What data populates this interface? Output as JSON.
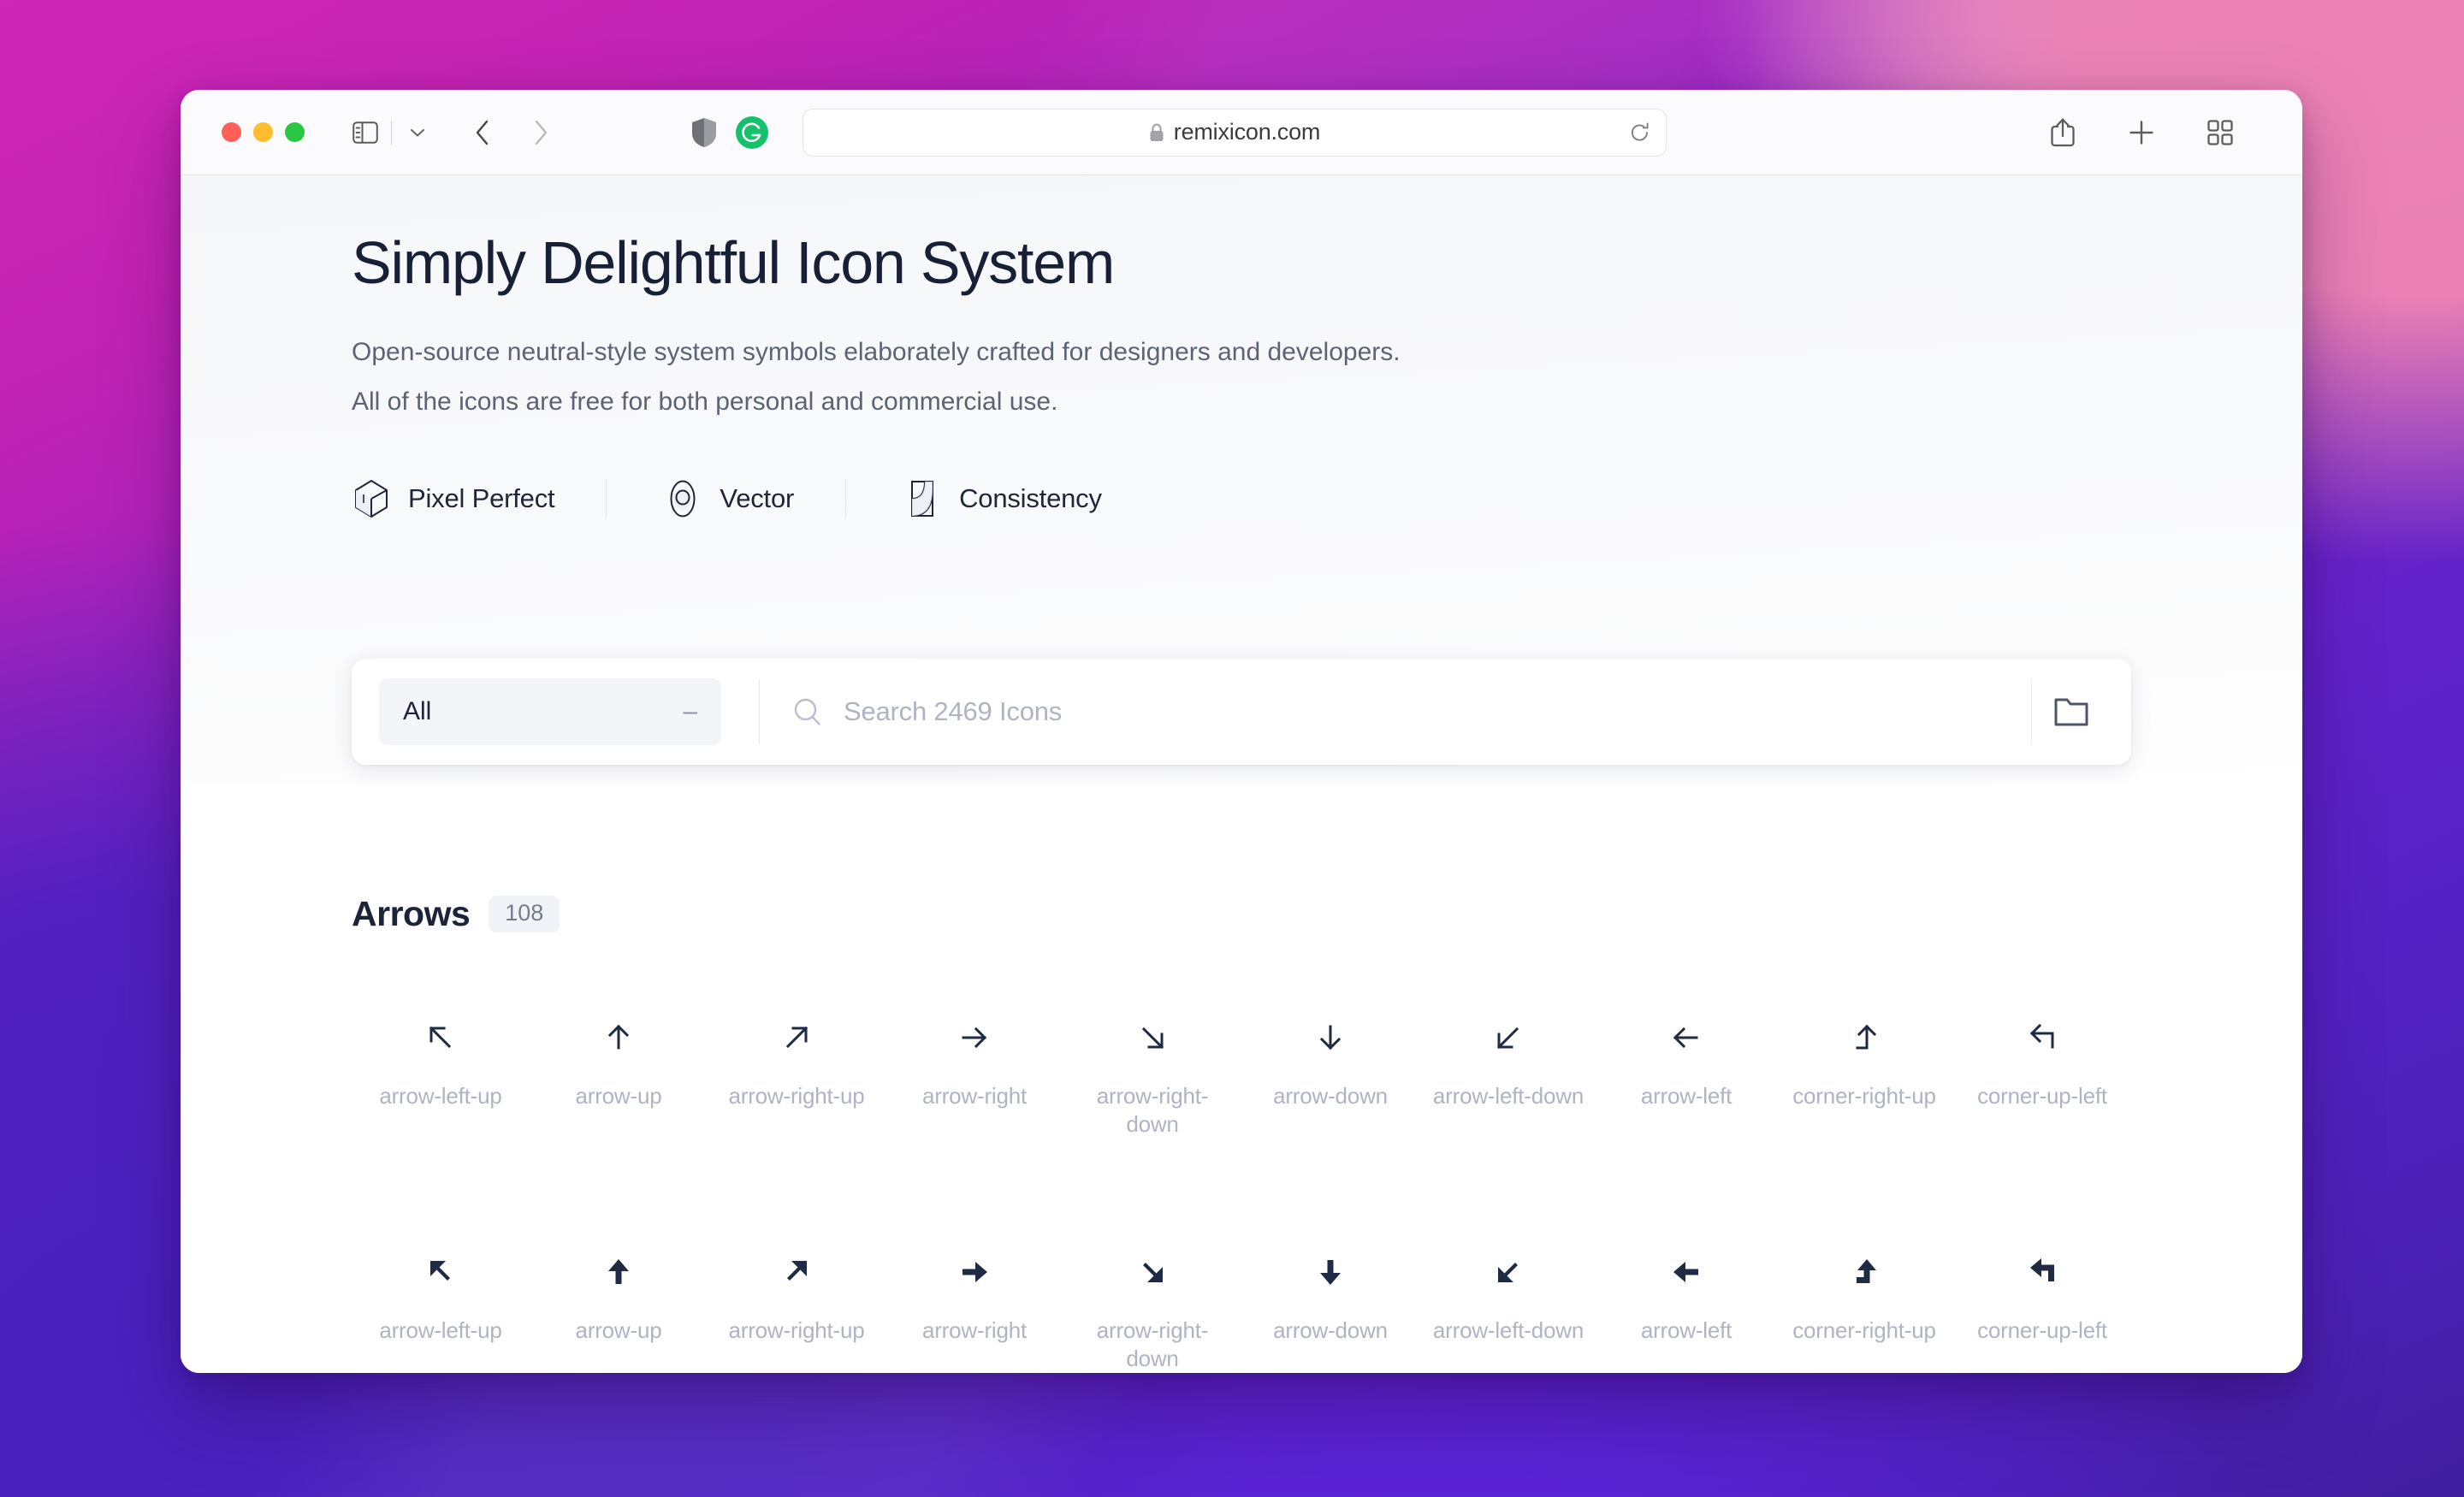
{
  "browser": {
    "url": "remixicon.com",
    "lock_icon": "lock-icon",
    "reload_icon": "reload-icon",
    "sidebar_icon": "sidebar-toggle-icon",
    "tab_overview_icon": "tab-overview-icon",
    "back_icon": "chevron-left-icon",
    "forward_icon": "chevron-right-icon",
    "share_icon": "share-icon",
    "new_tab_icon": "plus-icon",
    "extensions": [
      {
        "name": "shield-icon",
        "label": "Shield"
      },
      {
        "name": "grammarly-icon",
        "label": "G"
      }
    ]
  },
  "hero": {
    "title": "Simply Delightful Icon System",
    "subtitle_line1": "Open-source neutral-style system symbols elaborately crafted for designers and developers.",
    "subtitle_line2": "All of the icons are free for both personal and commercial use.",
    "features": [
      {
        "label": "Pixel Perfect",
        "icon": "cube-icon"
      },
      {
        "label": "Vector",
        "icon": "circle-vector-icon"
      },
      {
        "label": "Consistency",
        "icon": "square-curve-icon"
      }
    ]
  },
  "search": {
    "category_label": "All",
    "category_indicator": "–",
    "placeholder": "Search 2469 Icons",
    "search_icon": "search-icon",
    "folder_icon": "folder-icon"
  },
  "catalog": {
    "section_title": "Arrows",
    "section_count": "108",
    "rows": [
      {
        "style": "line",
        "icons": [
          {
            "name": "arrow-left-up",
            "glyph": "arrow-left-up-line-icon"
          },
          {
            "name": "arrow-up",
            "glyph": "arrow-up-line-icon"
          },
          {
            "name": "arrow-right-up",
            "glyph": "arrow-right-up-line-icon"
          },
          {
            "name": "arrow-right",
            "glyph": "arrow-right-line-icon"
          },
          {
            "name": "arrow-right-down",
            "glyph": "arrow-right-down-line-icon"
          },
          {
            "name": "arrow-down",
            "glyph": "arrow-down-line-icon"
          },
          {
            "name": "arrow-left-down",
            "glyph": "arrow-left-down-line-icon"
          },
          {
            "name": "arrow-left",
            "glyph": "arrow-left-line-icon"
          },
          {
            "name": "corner-right-up",
            "glyph": "corner-right-up-line-icon"
          },
          {
            "name": "corner-up-left",
            "glyph": "corner-up-left-line-icon"
          }
        ]
      },
      {
        "style": "fill",
        "icons": [
          {
            "name": "arrow-left-up",
            "glyph": "arrow-left-up-fill-icon"
          },
          {
            "name": "arrow-up",
            "glyph": "arrow-up-fill-icon"
          },
          {
            "name": "arrow-right-up",
            "glyph": "arrow-right-up-fill-icon"
          },
          {
            "name": "arrow-right",
            "glyph": "arrow-right-fill-icon"
          },
          {
            "name": "arrow-right-down",
            "glyph": "arrow-right-down-fill-icon"
          },
          {
            "name": "arrow-down",
            "glyph": "arrow-down-fill-icon"
          },
          {
            "name": "arrow-left-down",
            "glyph": "arrow-left-down-fill-icon"
          },
          {
            "name": "arrow-left",
            "glyph": "arrow-left-fill-icon"
          },
          {
            "name": "corner-right-up",
            "glyph": "corner-right-up-fill-icon"
          },
          {
            "name": "corner-up-left",
            "glyph": "corner-up-left-fill-icon"
          }
        ]
      }
    ]
  },
  "colors": {
    "heading": "#172036",
    "body_text": "#5b6475",
    "icon_dark": "#1f2a44",
    "icon_label": "#aeb4c4",
    "grammarly_green": "#15c26b",
    "traffic_red": "#ff5f57",
    "traffic_yellow": "#febc2e",
    "traffic_green": "#28c840"
  }
}
